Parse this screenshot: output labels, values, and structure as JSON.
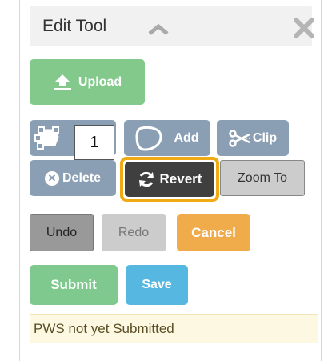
{
  "panel": {
    "title": "Edit Tool",
    "collapse_icon": "chevron-up-icon",
    "close_icon": "close-icon"
  },
  "buttons": {
    "upload": "Upload",
    "edit_vertices_icon": "edit-vertices-icon",
    "add": "Add",
    "clip": "Clip",
    "delete": "Delete",
    "revert": "Revert",
    "zoom_to": "Zoom To",
    "undo": "Undo",
    "redo": "Redo",
    "cancel": "Cancel",
    "submit": "Submit",
    "save": "Save"
  },
  "tooltip": {
    "text": "1"
  },
  "status": {
    "text": "PWS not yet Submitted"
  },
  "colors": {
    "primary_gray": "#8a9eb4",
    "highlight": "#f0aa13",
    "success": "#82c98b",
    "warning": "#f0ab4a",
    "info": "#56b8e0",
    "dark": "#3f3f3f"
  }
}
